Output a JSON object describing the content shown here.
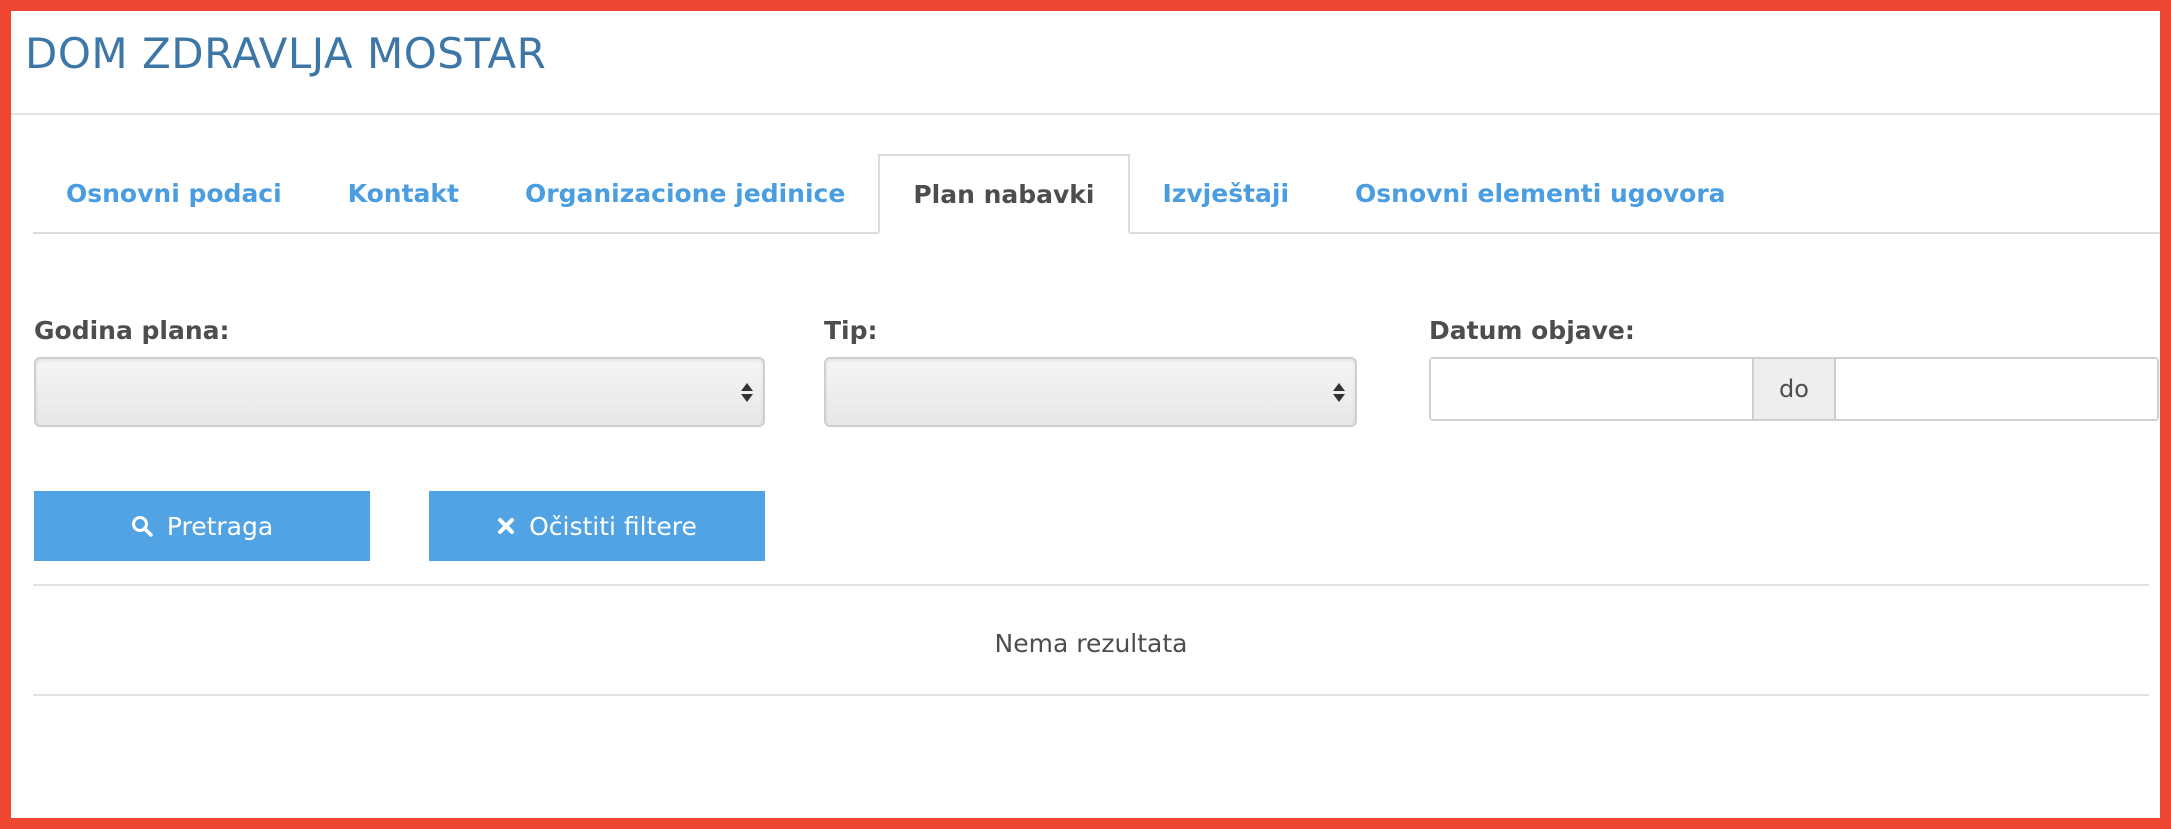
{
  "header": {
    "title": "DOM ZDRAVLJA MOSTAR"
  },
  "tabs": [
    {
      "label": "Osnovni podaci",
      "active": false
    },
    {
      "label": "Kontakt",
      "active": false
    },
    {
      "label": "Organizacione jedinice",
      "active": false
    },
    {
      "label": "Plan nabavki",
      "active": true
    },
    {
      "label": "Izvještaji",
      "active": false
    },
    {
      "label": "Osnovni elementi ugovora",
      "active": false
    }
  ],
  "filters": {
    "year": {
      "label": "Godina plana:",
      "value": ""
    },
    "type": {
      "label": "Tip:",
      "value": ""
    },
    "date": {
      "label": "Datum objave:",
      "from": "",
      "separator": "do",
      "to": ""
    }
  },
  "buttons": {
    "search": {
      "label": "Pretraga",
      "icon": "search-icon"
    },
    "clear": {
      "label": "Očistiti filtere",
      "icon": "close-icon"
    }
  },
  "results": {
    "empty_message": "Nema rezultata"
  },
  "colors": {
    "frame": "#ee4630",
    "title": "#3d77a8",
    "tab": "#4a9de0",
    "button": "#52a3e4"
  }
}
